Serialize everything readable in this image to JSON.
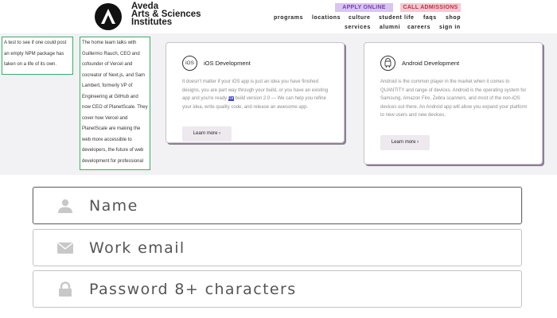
{
  "header": {
    "brand_line1": "Aveda",
    "brand_line2": "Arts & Sciences",
    "brand_line3": "Institutes",
    "apply_label": "APPLY ONLINE",
    "call_label": "CALL ADMISSIONS",
    "nav_row1": [
      "programs",
      "locations",
      "culture",
      "student life",
      "faqs",
      "shop"
    ],
    "nav_row2": [
      "services",
      "alumni",
      "careers",
      "sign in"
    ],
    "colors": {
      "apply_bg": "#d8c5f0",
      "call_bg": "#f5c9d3"
    }
  },
  "notes": {
    "small": "A test to see if one could post an empty NPM package has taken on a life of its own.",
    "large": "The home team talks with Guillermo Rauch, CEO and cofounder of Vercel and cocreator of Next.js, and Sam Lambert, formerly VP of Engineering at GitHub and now CEO of PlanetScale. They cover how Vercel and PlanetScale are making the web more accessible to developers, the future of web development for professional programmers, and why human laziness is the ultimate security threat."
  },
  "cards": {
    "ios": {
      "icon": "iOS",
      "title": "iOS Development",
      "body_before": "It doesn't matter if your iOS app is just an idea you have finished designs, you are part way through your build, or you have an existing app and you're ready ",
      "body_highlight": "for",
      "body_after": " build version 2.0 — We can help you refine your idea, write quality code, and release an awesome app.",
      "learn_more": "Learn more ›"
    },
    "android": {
      "icon": "android-robot-icon",
      "title": "Android Development",
      "body": "Android is the common player in the market when it comes to QUANTITY and range of devices. Android is the operating system for Samsung, Amazon Fire, Zebra scanners, and most of the non-iOS devices out there. An Android app will allow you expand your platform to new users and new devices.",
      "learn_more": "Learn more ›"
    }
  },
  "form": {
    "name_placeholder": "Name",
    "email_placeholder": "Work email",
    "password_placeholder": "Password 8+ characters"
  }
}
